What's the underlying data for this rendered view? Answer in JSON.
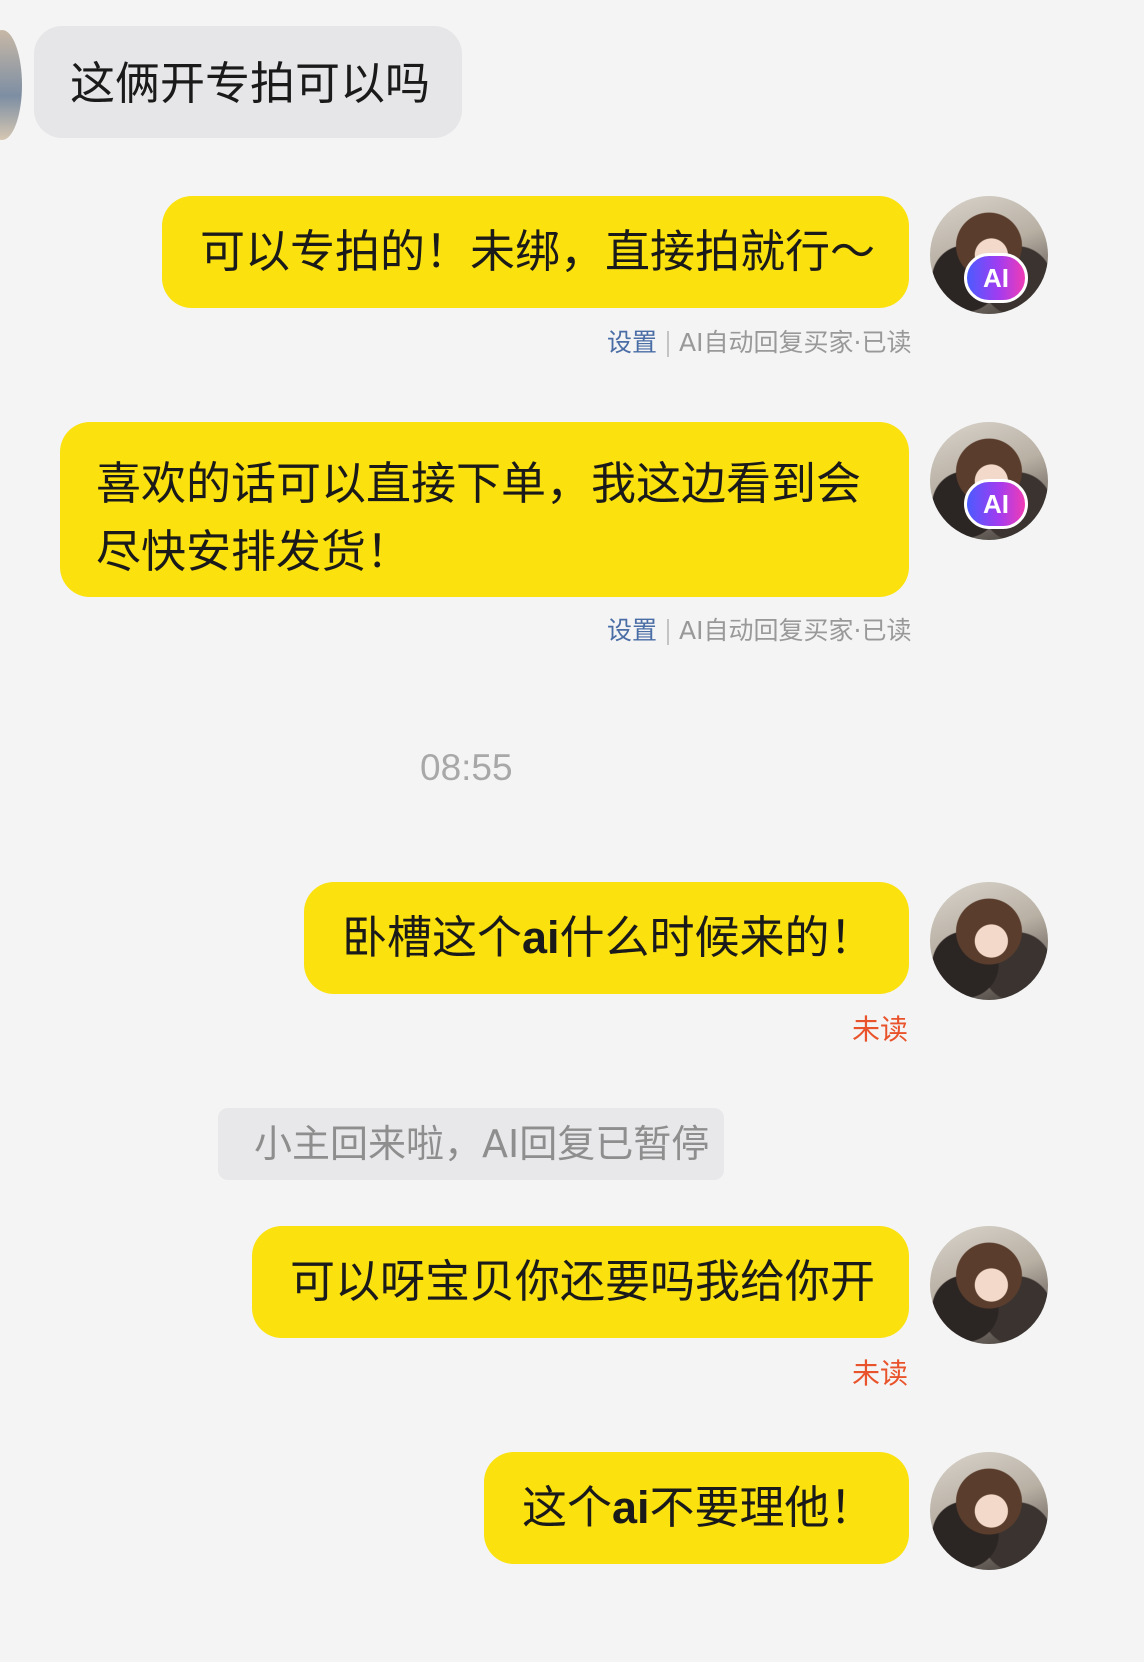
{
  "messages": [
    {
      "id": "m1",
      "side": "in",
      "text": "这俩开专拍可以吗"
    },
    {
      "id": "m2",
      "side": "out",
      "text": "可以专拍的！未绑，直接拍就行～",
      "ai": true,
      "meta": {
        "settings_label": "设置",
        "status": "AI自动回复买家·已读"
      }
    },
    {
      "id": "m3",
      "side": "out",
      "text": "喜欢的话可以直接下单，我这边看到会尽快安排发货！",
      "ai": true,
      "meta": {
        "settings_label": "设置",
        "status": "AI自动回复买家·已读"
      }
    },
    {
      "id": "m4",
      "side": "out",
      "text_before": "卧槽这个",
      "text_ai": "ai",
      "text_after": "什么时候来的！",
      "status": "未读"
    },
    {
      "id": "m5",
      "side": "out",
      "text": "可以呀宝贝你还要吗我给你开",
      "status": "未读"
    },
    {
      "id": "m6",
      "side": "out",
      "text_before": "这个",
      "text_ai": "ai",
      "text_after": "不要理他！"
    }
  ],
  "timestamp": "08:55",
  "system_note": "小主回来啦，AI回复已暂停",
  "ai_badge_label": "AI",
  "colors": {
    "background": "#f4f4f4",
    "incoming_bubble": "#e6e6e8",
    "outgoing_bubble": "#fbe10d",
    "unread": "#e9532b",
    "settings_link": "#4a6da5"
  }
}
